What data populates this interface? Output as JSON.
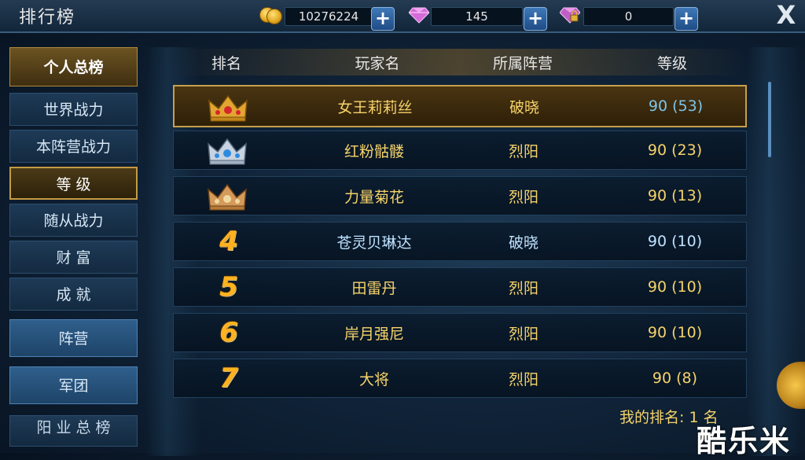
{
  "topbar": {
    "title": "排行榜",
    "gold": "10276224",
    "gems": "145",
    "locked_gems": "0",
    "close": "X"
  },
  "sidebar": {
    "items": [
      {
        "label": "个人总榜"
      },
      {
        "label": "世界战力"
      },
      {
        "label": "本阵营战力"
      },
      {
        "label": "等  级"
      },
      {
        "label": "随从战力"
      },
      {
        "label": "财  富"
      },
      {
        "label": "成  就"
      },
      {
        "label": "阵营"
      },
      {
        "label": "军团"
      },
      {
        "label": "阳 业 总 榜"
      }
    ]
  },
  "table": {
    "headers": {
      "rank": "排名",
      "player": "玩家名",
      "camp": "所属阵营",
      "level": "等级"
    },
    "rows": [
      {
        "rank": "1",
        "name": "女王莉莉丝",
        "camp": "破晓",
        "level": "90 (53)"
      },
      {
        "rank": "2",
        "name": "红粉骷髅",
        "camp": "烈阳",
        "level": "90 (23)"
      },
      {
        "rank": "3",
        "name": "力量菊花",
        "camp": "烈阳",
        "level": "90 (13)"
      },
      {
        "rank": "4",
        "name": "苍灵贝琳达",
        "camp": "破晓",
        "level": "90 (10)"
      },
      {
        "rank": "5",
        "name": "田雷丹",
        "camp": "烈阳",
        "level": "90 (10)"
      },
      {
        "rank": "6",
        "name": "岸月强尼",
        "camp": "烈阳",
        "level": "90 (10)"
      },
      {
        "rank": "7",
        "name": "大将",
        "camp": "烈阳",
        "level": "90 (8)"
      }
    ]
  },
  "footer": {
    "my_rank": "我的排名: 1  名",
    "watermark": "酷乐米"
  },
  "colors": {
    "gold_text": "#f6d36a",
    "blue_text": "#bfe3ff",
    "rank_orange": "#ffb21e"
  }
}
